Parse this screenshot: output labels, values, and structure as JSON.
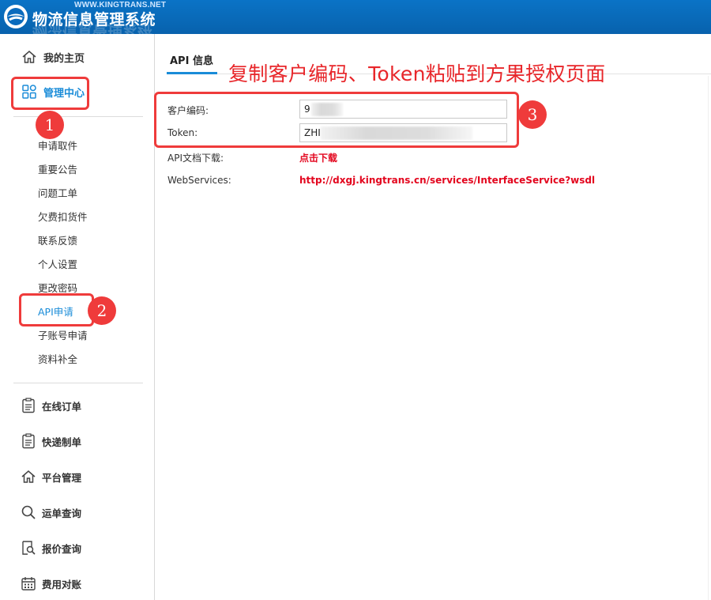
{
  "header": {
    "url": "WWW.KINGTRANS.NET",
    "title": "物流信息管理系统"
  },
  "sidebar": {
    "home": "我的主页",
    "management": "管理中心",
    "sub_items": [
      "申请取件",
      "重要公告",
      "问题工单",
      "欠费扣货件",
      "联系反馈",
      "个人设置",
      "更改密码",
      "API申请",
      "子账号申请",
      "资料补全"
    ],
    "bottom_items": [
      "在线订单",
      "快递制单",
      "平台管理",
      "运单查询",
      "报价查询",
      "费用对账"
    ]
  },
  "main": {
    "tab_label": "API 信息",
    "annotation": "复制客户编码、Token粘贴到方果授权页面",
    "customer_code_label": "客户编码:",
    "customer_code_value": "9",
    "token_label": "Token:",
    "token_value": "ZHI",
    "api_doc_label": "API文档下载:",
    "api_doc_link": "点击下载",
    "webservices_label": "WebServices:",
    "webservices_link": "http://dxgj.kingtrans.cn/services/InterfaceService?wsdl"
  },
  "badges": [
    "1",
    "2",
    "3"
  ],
  "colors": {
    "header_blue": "#0862ad",
    "active_blue": "#1a8cd8",
    "annotation_red": "#ef3b3b",
    "link_red": "#e3061e"
  }
}
